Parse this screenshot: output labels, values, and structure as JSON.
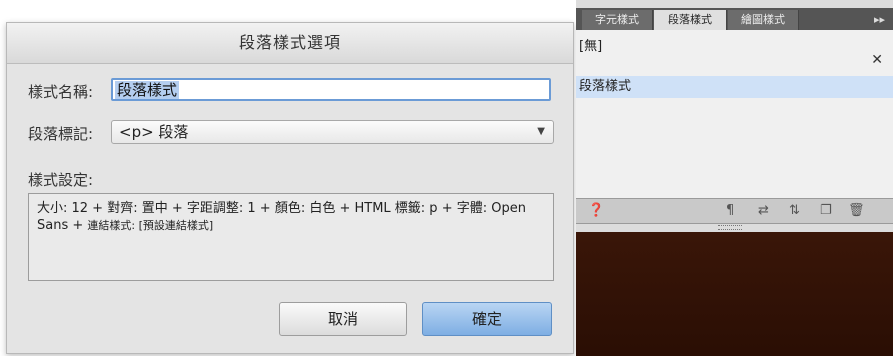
{
  "dialog": {
    "title": "段落樣式選項",
    "style_name_label": "樣式名稱:",
    "style_name_value": "段落樣式",
    "paragraph_tag_label": "段落標記:",
    "paragraph_tag_value": "<p> 段落",
    "style_settings_label": "樣式設定:",
    "style_settings_text_main": "大小: 12 + 對齊: 置中 + 字距調整: 1 + 顏色: 白色 + HTML 標籤: p + 字體: Open Sans + ",
    "style_settings_text_small": "連結樣式: [預設連結樣式]",
    "cancel_label": "取消",
    "ok_label": "確定"
  },
  "panel": {
    "tabs": [
      {
        "label": "字元樣式"
      },
      {
        "label": "段落樣式"
      },
      {
        "label": "繪圖樣式"
      }
    ],
    "active_tab": "段落樣式",
    "items": [
      {
        "label": "[無]"
      },
      {
        "label": "段落樣式"
      }
    ],
    "selected_item": "段落樣式"
  },
  "icons": {
    "more": "panel-menu-icon",
    "clear": "clear-overrides-icon",
    "help": "help-icon",
    "paragraph": "paragraph-icon",
    "link": "link-icon",
    "load": "load-styles-icon",
    "new": "new-style-icon",
    "delete": "trash-icon"
  },
  "colors": {
    "accent": "#6b9bd6",
    "ok_button": "#7eaee3",
    "selection": "#cfe1f7",
    "background_dark": "#2a0e04"
  }
}
